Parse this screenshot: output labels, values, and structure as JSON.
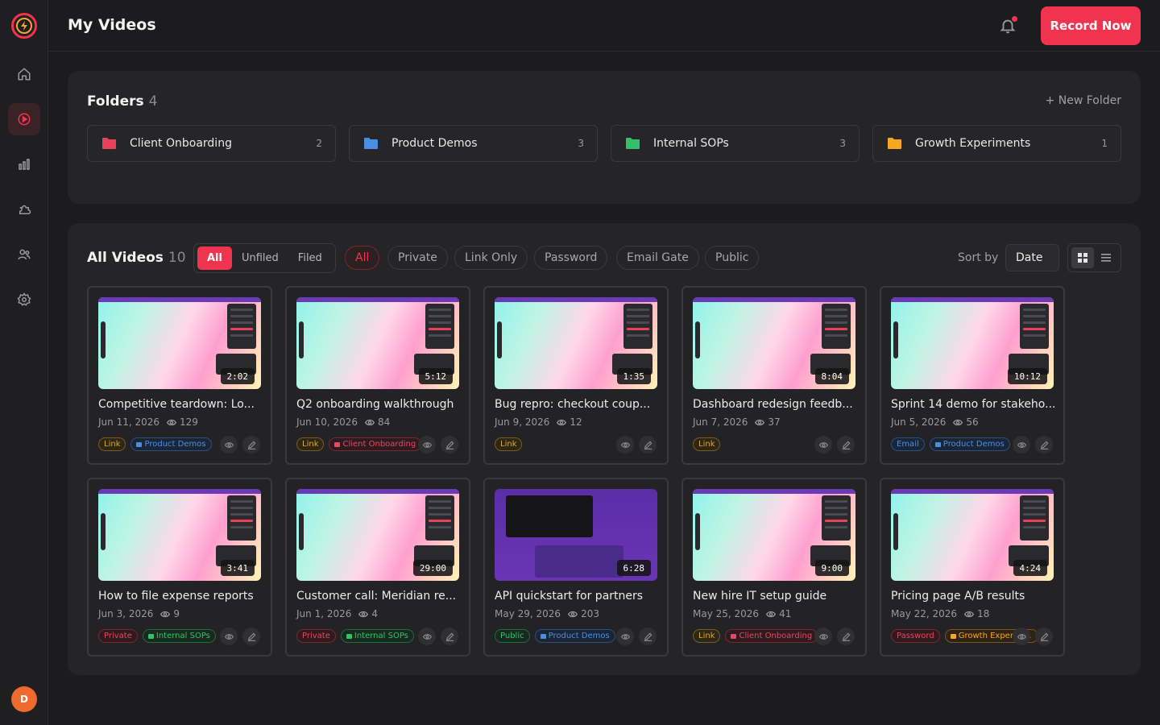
{
  "header": {
    "title": "My Videos",
    "record_label": "Record Now"
  },
  "sidebar": {
    "items": [
      {
        "name": "home",
        "icon": "home-icon"
      },
      {
        "name": "videos",
        "icon": "play-icon",
        "active": true
      },
      {
        "name": "analytics",
        "icon": "bar-chart-icon"
      },
      {
        "name": "integrations",
        "icon": "puzzle-icon"
      },
      {
        "name": "team",
        "icon": "users-icon"
      },
      {
        "name": "settings",
        "icon": "gear-icon"
      }
    ],
    "avatar_initial": "D"
  },
  "folders": {
    "title": "Folders",
    "count": "4",
    "new_label": "+ New Folder",
    "items": [
      {
        "name": "Client Onboarding",
        "count": "2",
        "color": "#e8415a"
      },
      {
        "name": "Product Demos",
        "count": "3",
        "color": "#4a90e2"
      },
      {
        "name": "Internal SOPs",
        "count": "3",
        "color": "#34c06b"
      },
      {
        "name": "Growth Experiments",
        "count": "1",
        "color": "#f5a623"
      }
    ]
  },
  "videos": {
    "title": "All Videos",
    "count": "10",
    "segments": [
      "All",
      "Unfiled",
      "Filed"
    ],
    "filters": [
      "All",
      "Private",
      "Link Only",
      "Password",
      "Email Gate",
      "Public"
    ],
    "sort_label": "Sort by",
    "sort_value": "Date",
    "items": [
      {
        "title": "Competitive teardown: Lo...",
        "date": "Jun 11, 2026",
        "views": "129",
        "duration": "2:02",
        "privacy": "Link",
        "folder": "Product Demos"
      },
      {
        "title": "Q2 onboarding walkthrough",
        "date": "Jun 10, 2026",
        "views": "84",
        "duration": "5:12",
        "privacy": "Link",
        "folder": "Client Onboarding"
      },
      {
        "title": "Bug repro: checkout coup...",
        "date": "Jun 9, 2026",
        "views": "12",
        "duration": "1:35",
        "privacy": "Link",
        "folder": ""
      },
      {
        "title": "Dashboard redesign feedb...",
        "date": "Jun 7, 2026",
        "views": "37",
        "duration": "8:04",
        "privacy": "Link",
        "folder": ""
      },
      {
        "title": "Sprint 14 demo for stakeho...",
        "date": "Jun 5, 2026",
        "views": "56",
        "duration": "10:12",
        "privacy": "Email",
        "folder": "Product Demos"
      },
      {
        "title": "How to file expense reports",
        "date": "Jun 3, 2026",
        "views": "9",
        "duration": "3:41",
        "privacy": "Private",
        "folder": "Internal SOPs"
      },
      {
        "title": "Customer call: Meridian re...",
        "date": "Jun 1, 2026",
        "views": "4",
        "duration": "29:00",
        "privacy": "Private",
        "folder": "Internal SOPs"
      },
      {
        "title": "API quickstart for partners",
        "date": "May 29, 2026",
        "views": "203",
        "duration": "6:28",
        "privacy": "Public",
        "folder": "Product Demos"
      },
      {
        "title": "New hire IT setup guide",
        "date": "May 25, 2026",
        "views": "41",
        "duration": "9:00",
        "privacy": "Link",
        "folder": "Client Onboarding"
      },
      {
        "title": "Pricing page A/B results",
        "date": "May 22, 2026",
        "views": "18",
        "duration": "4:24",
        "privacy": "Password",
        "folder": "Growth Experime..."
      }
    ]
  }
}
